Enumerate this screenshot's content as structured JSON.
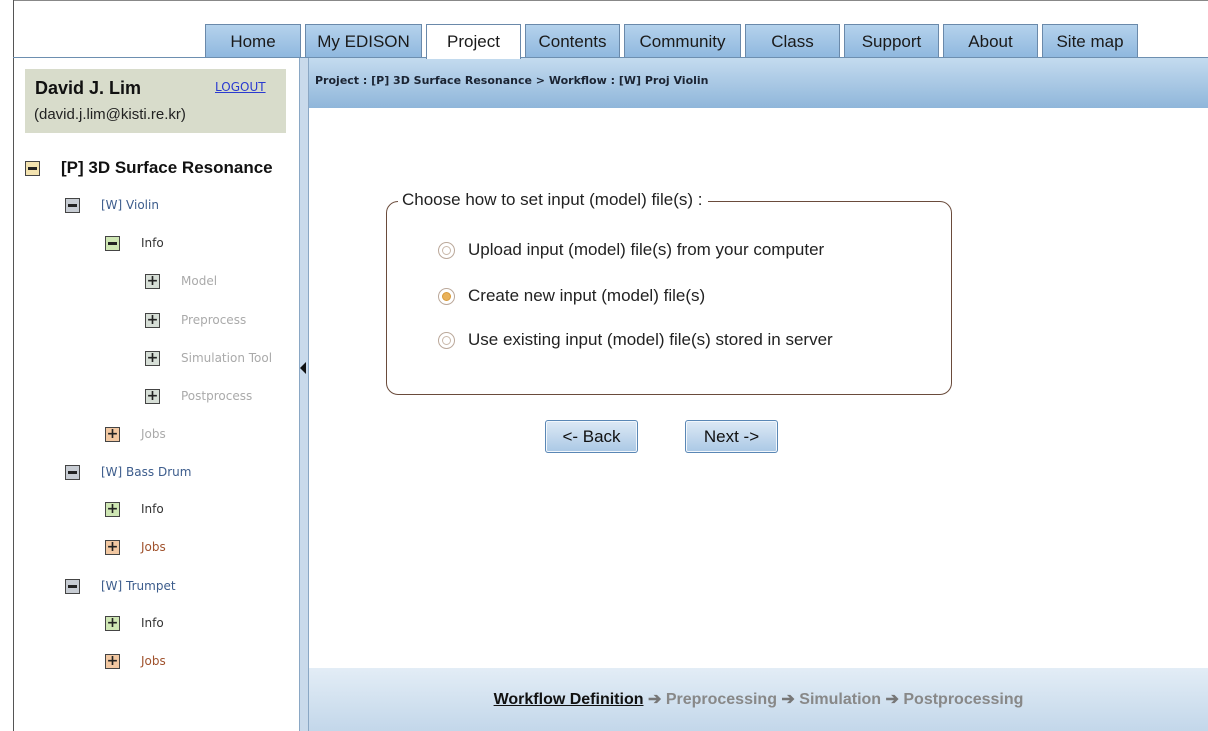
{
  "nav": {
    "tabs": [
      "Home",
      "My EDISON",
      "Project",
      "Contents",
      "Community",
      "Class",
      "Support",
      "About",
      "Site map"
    ],
    "active": "Project"
  },
  "user": {
    "name": "David J. Lim",
    "email": "(david.j.lim@kisti.re.kr)",
    "logout_label": "LOGOUT"
  },
  "tree": {
    "project": "[P] 3D Surface Resonance",
    "violin": {
      "label": "[W] Violin",
      "info": "Info",
      "steps": [
        "Model",
        "Preprocess",
        "Simulation Tool",
        "Postprocess"
      ],
      "jobs": "Jobs"
    },
    "bass_drum": {
      "label": "[W] Bass Drum",
      "info": "Info",
      "jobs": "Jobs"
    },
    "trumpet": {
      "label": "[W] Trumpet",
      "info": "Info",
      "jobs": "Jobs"
    }
  },
  "breadcrumb": "Project : [P] 3D Surface Resonance > Workflow : [W] Proj Violin",
  "input_choice": {
    "legend": "Choose how to set input (model) file(s) :",
    "options": [
      "Upload input (model) file(s) from your computer",
      "Create new input (model) file(s)",
      "Use existing input (model) file(s) stored in server"
    ],
    "selected": "Create new input (model) file(s)"
  },
  "buttons": {
    "back": "<- Back",
    "next": "Next ->"
  },
  "workflow_steps": {
    "current": "Workflow Definition",
    "arrow": "➔",
    "rest": [
      "Preprocessing",
      "Simulation",
      "Postprocessing"
    ]
  },
  "colors": {
    "tab_blue": "#9fc3e6",
    "breadcrumb_bar": "#a9c9e6",
    "user_box": "#d8dccb",
    "radio_selected": "#e9b25a"
  }
}
